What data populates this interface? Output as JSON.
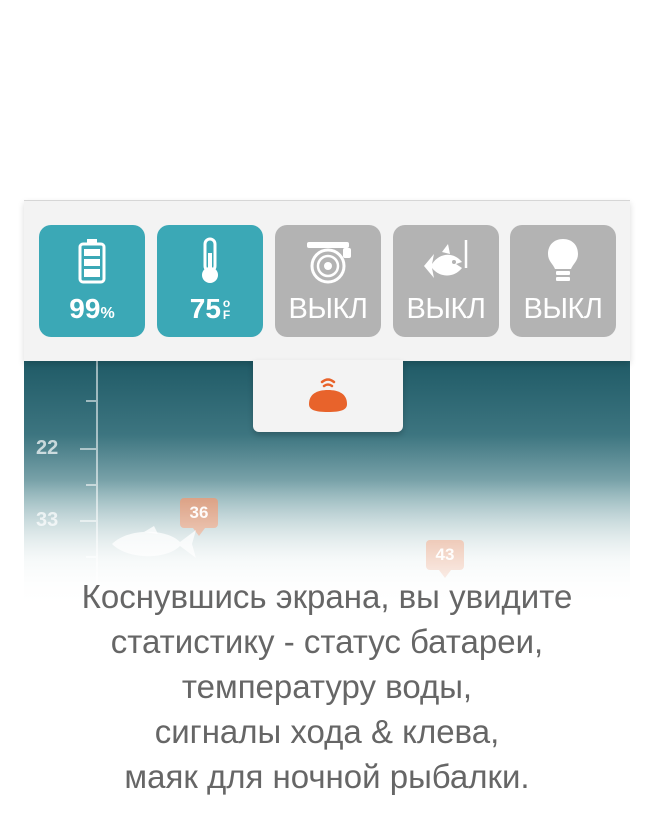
{
  "status_panel": {
    "tiles": [
      {
        "id": "battery",
        "icon": "battery-icon",
        "value": "99",
        "unit": "%",
        "active": true
      },
      {
        "id": "temperature",
        "icon": "thermometer-icon",
        "value": "75",
        "unit_top": "o",
        "unit_bottom": "F",
        "active": true
      },
      {
        "id": "alarm",
        "icon": "alarm-bell-icon",
        "value": "ВЫКЛ",
        "active": false
      },
      {
        "id": "fish-alarm",
        "icon": "fish-bite-icon",
        "value": "ВЫКЛ",
        "active": false
      },
      {
        "id": "night-light",
        "icon": "lightbulb-icon",
        "value": "ВЫКЛ",
        "active": false
      }
    ],
    "colors": {
      "active": "#3ba8b6",
      "inactive": "#b3b3b3",
      "sonar_accent": "#e8632b"
    }
  },
  "sonar": {
    "depth_labels": [
      "22",
      "33"
    ],
    "fish_markers": [
      "36",
      "43"
    ]
  },
  "caption": {
    "lines": [
      "Коснувшись экрана, вы увидите",
      "статистику - статус батареи,",
      "температуру воды,",
      "сигналы хода & клева,",
      "маяк для ночной рыбалки."
    ]
  }
}
